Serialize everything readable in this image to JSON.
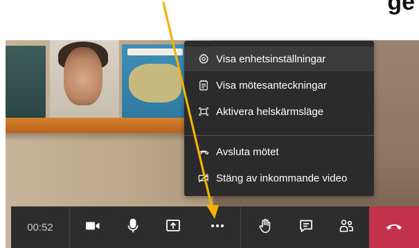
{
  "caption": {
    "text": "ge"
  },
  "menu": {
    "items": [
      {
        "label": "Visa enhetsinställningar",
        "icon": "gear-icon",
        "highlighted": true
      },
      {
        "label": "Visa mötesanteckningar",
        "icon": "notes-icon",
        "highlighted": false
      },
      {
        "label": "Aktivera helskärmsläge",
        "icon": "fullscreen-icon",
        "highlighted": false
      },
      {
        "label": "Avsluta mötet",
        "icon": "end-meeting-icon",
        "highlighted": false
      },
      {
        "label": "Stäng av inkommande video",
        "icon": "video-off-icon",
        "highlighted": false
      }
    ]
  },
  "call_bar": {
    "timer": "00:52",
    "buttons": [
      {
        "id": "camera",
        "icon": "camera-icon"
      },
      {
        "id": "microphone",
        "icon": "microphone-icon"
      },
      {
        "id": "share",
        "icon": "share-screen-icon"
      },
      {
        "id": "more",
        "icon": "more-options-icon"
      },
      {
        "id": "raise-hand",
        "icon": "raise-hand-icon"
      },
      {
        "id": "chat",
        "icon": "chat-icon"
      },
      {
        "id": "participants",
        "icon": "participants-icon"
      }
    ],
    "hangup_icon": "hang-up-icon",
    "colors": {
      "bar": "#2d2d2d",
      "hangup": "#c4314b",
      "icon": "#ffffff"
    }
  },
  "annotation": {
    "arrow_color": "#f5b301"
  }
}
